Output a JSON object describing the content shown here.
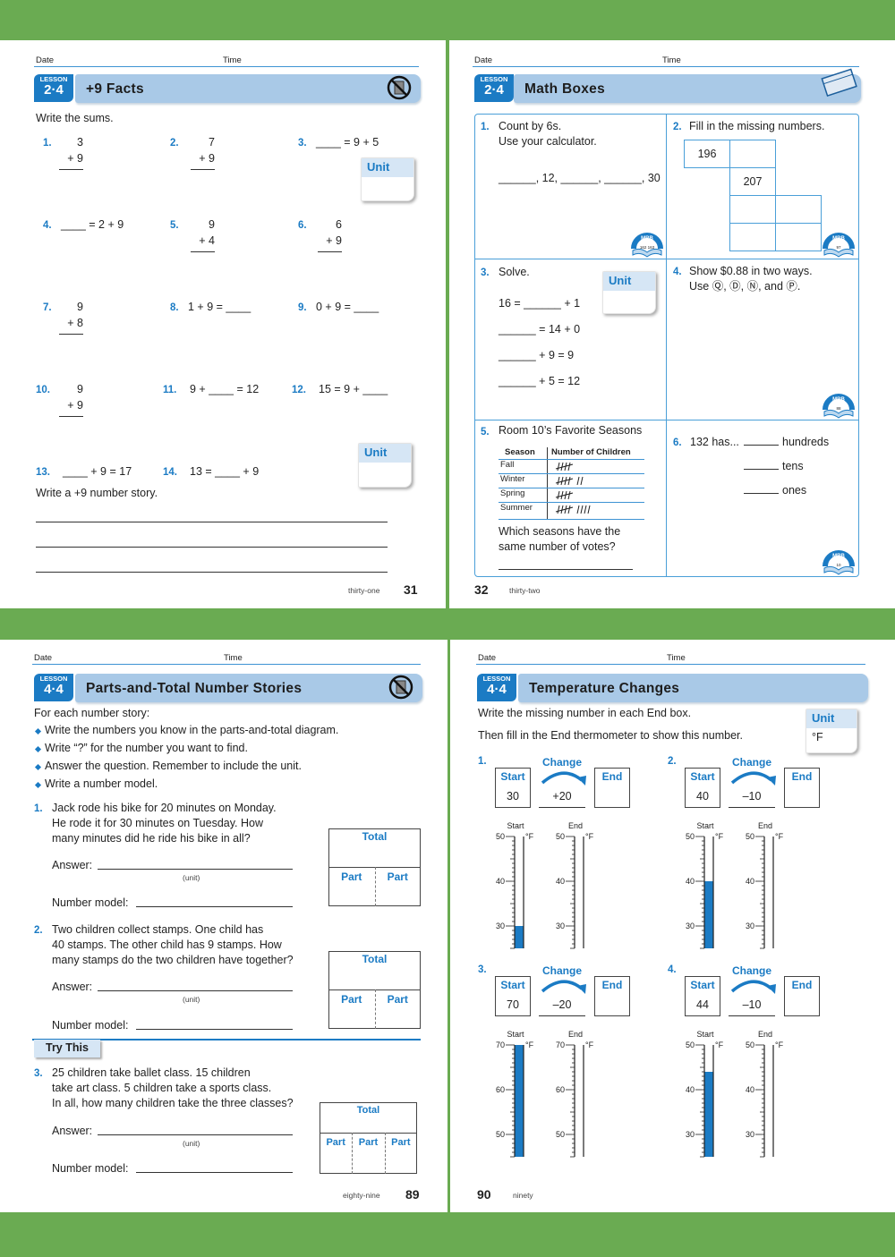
{
  "colors": {
    "background": "#6aab52",
    "accent": "#1b7bc4",
    "title_bar": "#a9c9e7",
    "fill": "#1b7bc4"
  },
  "common": {
    "date": "Date",
    "time": "Time",
    "lesson_label": "LESSON",
    "unit_label": "Unit"
  },
  "page31": {
    "lesson": "2·4",
    "title": "+9 Facts",
    "icon": "no-calculator-icon",
    "instruction": "Write the sums.",
    "problems": [
      {
        "n": "1.",
        "top": "3",
        "bottom": "+ 9"
      },
      {
        "n": "2.",
        "top": "7",
        "bottom": "+ 9"
      },
      {
        "n": "3.",
        "text": "____ = 9 + 5"
      },
      {
        "n": "4.",
        "text": "____ = 2 + 9"
      },
      {
        "n": "5.",
        "top": "9",
        "bottom": "+ 4"
      },
      {
        "n": "6.",
        "top": "6",
        "bottom": "+ 9"
      },
      {
        "n": "7.",
        "top": "9",
        "bottom": "+ 8"
      },
      {
        "n": "8.",
        "text": "1 + 9 = ____"
      },
      {
        "n": "9.",
        "text": "0 + 9 = ____"
      },
      {
        "n": "10.",
        "top": "9",
        "bottom": "+ 9"
      },
      {
        "n": "11.",
        "text": "9 + ____ = 12"
      },
      {
        "n": "12.",
        "text": "15 = 9 + ____"
      },
      {
        "n": "13.",
        "text": "____ + 9 = 17"
      },
      {
        "n": "14.",
        "text": "13 = ____ + 9"
      }
    ],
    "story_prompt": "Write a +9 number story.",
    "page_word": "thirty-one",
    "page_num": "31"
  },
  "page32": {
    "lesson": "2·4",
    "title": "Math Boxes",
    "icon": "math-boxes-icon",
    "box1": {
      "n": "1.",
      "line1": "Count by 6s.",
      "line2": "Use your calculator.",
      "sequence": "______, 12, ______, ______, 30",
      "mrb": "162 163"
    },
    "box2": {
      "n": "2.",
      "text": "Fill in the missing numbers.",
      "cells": [
        "196",
        "",
        "207",
        "",
        "",
        "",
        ""
      ],
      "mrb": "97"
    },
    "box3": {
      "n": "3.",
      "text": "Solve.",
      "equations": [
        "16 = ______ + 1",
        "______ = 14 + 0",
        "______ + 9 = 9",
        "______ + 5 = 12"
      ]
    },
    "box4": {
      "n": "4.",
      "line1": "Show $0.88 in two ways.",
      "line2": "Use Ⓠ, Ⓓ, Ⓝ, and Ⓟ.",
      "mrb": "88"
    },
    "box5": {
      "n": "5.",
      "title": "Room 10’s Favorite Seasons",
      "headers": [
        "Season",
        "Number of Children"
      ],
      "rows": [
        {
          "season": "Fall",
          "tally": 5
        },
        {
          "season": "Winter",
          "tally": 7
        },
        {
          "season": "Spring",
          "tally": 5
        },
        {
          "season": "Summer",
          "tally": 9
        }
      ],
      "question1": "Which seasons have the",
      "question2": "same number of votes?"
    },
    "box6": {
      "n": "6.",
      "lead": "132 has...",
      "labels": [
        "hundreds",
        "tens",
        "ones"
      ],
      "mrb": "10"
    },
    "mrb_label": "MRB",
    "page_word": "thirty-two",
    "page_num": "32"
  },
  "page89": {
    "lesson": "4·4",
    "title": "Parts-and-Total Number Stories",
    "icon": "no-calculator-icon",
    "intro": "For each number story:",
    "bullets": [
      "Write the numbers you know in the parts-and-total diagram.",
      "Write “?” for the number you want to find.",
      "Answer the question. Remember to include the unit.",
      "Write a number model."
    ],
    "problems": [
      {
        "n": "1.",
        "lines": [
          "Jack rode his bike for 20 minutes on Monday.",
          "He rode it for 30 minutes on Tuesday. How",
          "many minutes did he ride his bike in all?"
        ]
      },
      {
        "n": "2.",
        "lines": [
          "Two children collect stamps. One child has",
          "40 stamps. The other child has 9 stamps. How",
          "many stamps do the two children have together?"
        ]
      },
      {
        "n": "3.",
        "lines": [
          "25 children take ballet class. 15 children",
          "take art class. 5 children take a sports class.",
          "In all, how many children take the three classes?"
        ]
      }
    ],
    "answer_label": "Answer:",
    "unit_hint": "(unit)",
    "model_label": "Number model:",
    "total_label": "Total",
    "part_label": "Part",
    "try_this": "Try This",
    "page_word": "eighty-nine",
    "page_num": "89"
  },
  "page90": {
    "lesson": "4·4",
    "title": "Temperature Changes",
    "instruction1": "Write the missing number in each End box.",
    "instruction2": "Then fill in the End thermometer to show this number.",
    "unit_value": "°F",
    "labels": {
      "start": "Start",
      "change": "Change",
      "end": "End",
      "degree": "°F"
    },
    "problems": [
      {
        "n": "1.",
        "start": "30",
        "change": "+20",
        "start_value": 30,
        "ticks": [
          "50",
          "40",
          "30"
        ],
        "scale_max": 50,
        "scale_min": 25
      },
      {
        "n": "2.",
        "start": "40",
        "change": "–10",
        "start_value": 40,
        "ticks": [
          "50",
          "40",
          "30"
        ],
        "scale_max": 50,
        "scale_min": 25
      },
      {
        "n": "3.",
        "start": "70",
        "change": "–20",
        "start_value": 70,
        "ticks": [
          "70",
          "60",
          "50"
        ],
        "scale_max": 70,
        "scale_min": 45
      },
      {
        "n": "4.",
        "start": "44",
        "change": "–10",
        "start_value": 44,
        "ticks": [
          "50",
          "40",
          "30"
        ],
        "scale_max": 50,
        "scale_min": 25
      }
    ],
    "page_word": "ninety",
    "page_num": "90"
  }
}
